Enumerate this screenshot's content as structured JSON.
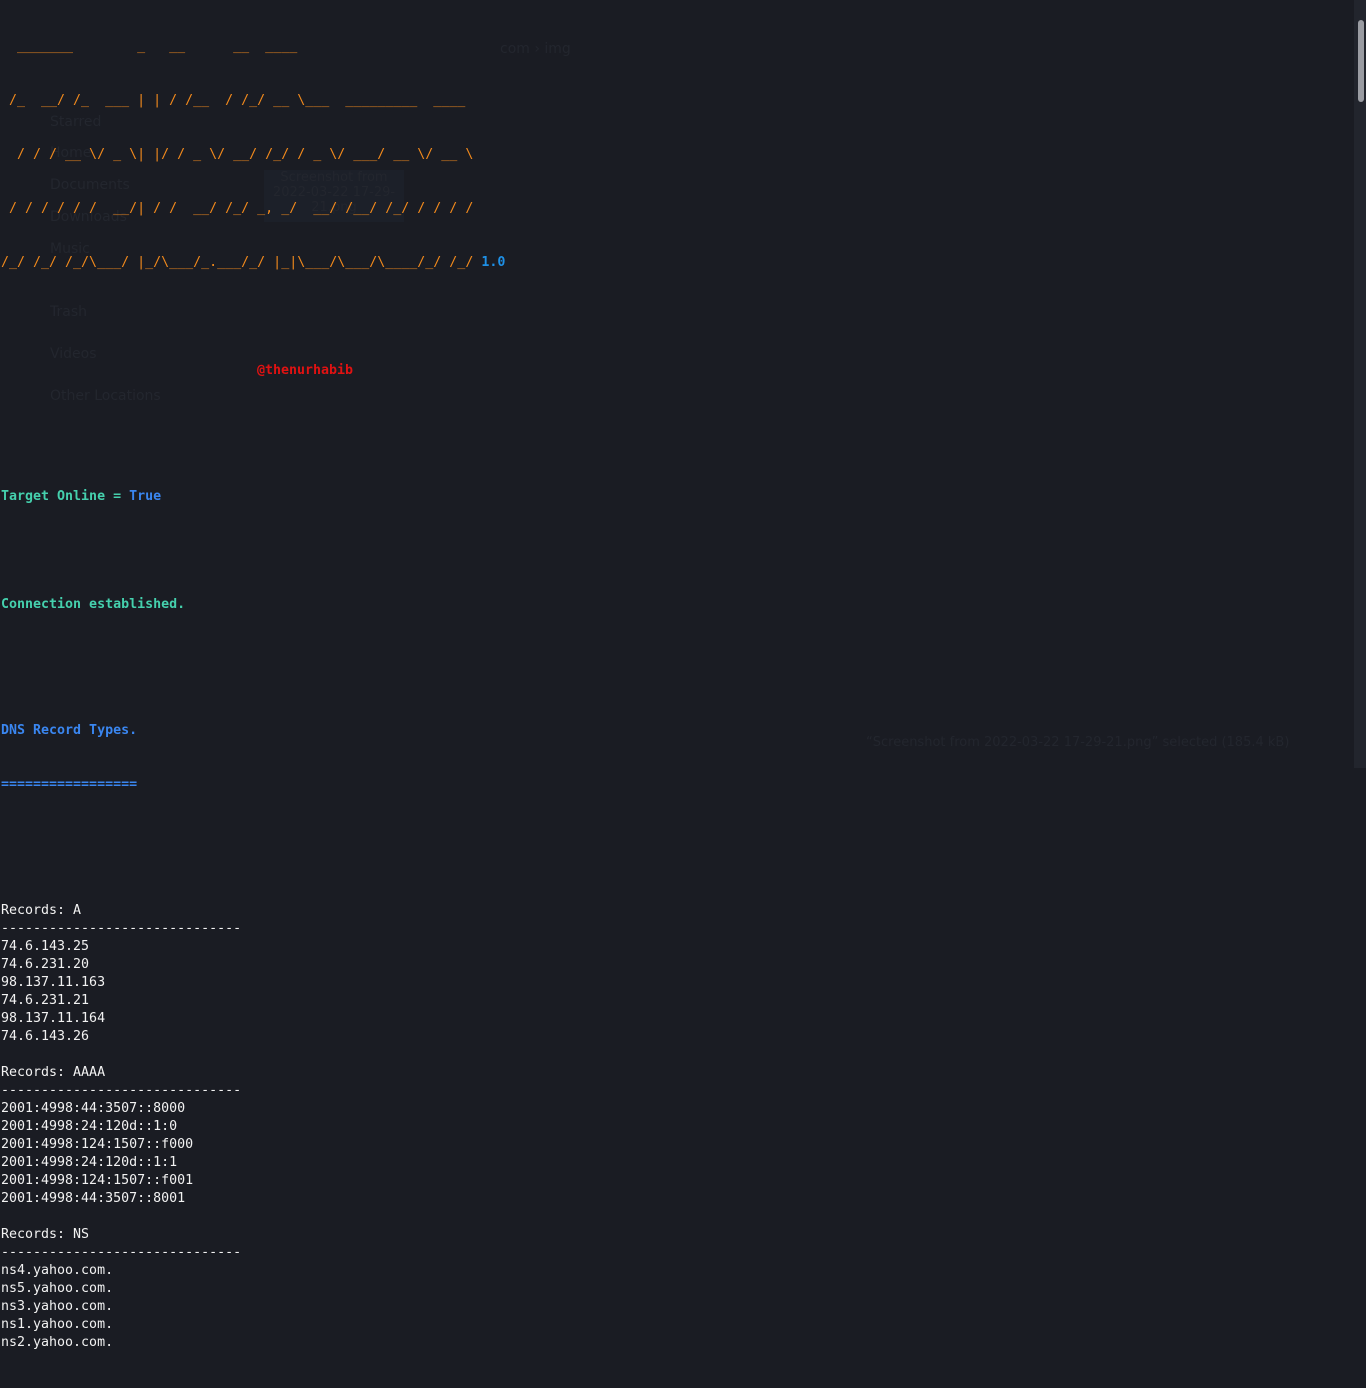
{
  "banner": {
    "art_lines": [
      "  _______        _   __      __  ____",
      " /_  __/ /_  ___ | | / /__  / /_/ __ \\___  _________  ____",
      "  / / / __ \\/ _ \\| |/ / _ \\/ __/ /_/ / _ \\/ ___/ __ \\/ __ \\",
      " / / / / / /  __/| / /  __/ /_/ _, _/  __/ /__/ /_/ / / / /",
      "/_/ /_/ /_/\\___/ |_/\\___/_.___/_/ |_|\\___/\\___/\\____/_/ /_/"
    ],
    "version": "1.0",
    "author": "@thenurhabib"
  },
  "status": {
    "target_online_label": "Target Online = ",
    "target_online_value": "True",
    "connection": "Connection established."
  },
  "dns": {
    "heading": "DNS Record Types.",
    "underline": "================="
  },
  "records": [
    {
      "label": "Records: A",
      "divider": "------------------------------",
      "values": [
        "74.6.143.25",
        "74.6.231.20",
        "98.137.11.163",
        "74.6.231.21",
        "98.137.11.164",
        "74.6.143.26"
      ]
    },
    {
      "label": "Records: AAAA",
      "divider": "------------------------------",
      "values": [
        "2001:4998:44:3507::8000",
        "2001:4998:24:120d::1:0",
        "2001:4998:124:1507::f000",
        "2001:4998:24:120d::1:1",
        "2001:4998:124:1507::f001",
        "2001:4998:44:3507::8001"
      ]
    },
    {
      "label": "Records: NS",
      "divider": "------------------------------",
      "values": [
        "ns4.yahoo.com.",
        "ns5.yahoo.com.",
        "ns3.yahoo.com.",
        "ns1.yahoo.com.",
        "ns2.yahoo.com."
      ]
    }
  ],
  "background_window": {
    "path": "com › img",
    "sidebar": [
      "Starred",
      "Home",
      "Documents",
      "Downloads",
      "Music",
      "Trash",
      "Videos",
      "Other Locations"
    ],
    "file_label": "Screenshot from 2022-03-22 17-29-21.png",
    "status_bar": "“Screenshot from 2022-03-22 17-29-21.png” selected (185.4 kB)"
  },
  "colors": {
    "background": "#1a1c23",
    "art": "#f28a1c",
    "version": "#1e90e6",
    "author": "#e01212",
    "teal": "#45d0ad",
    "blue": "#3a86f0"
  }
}
